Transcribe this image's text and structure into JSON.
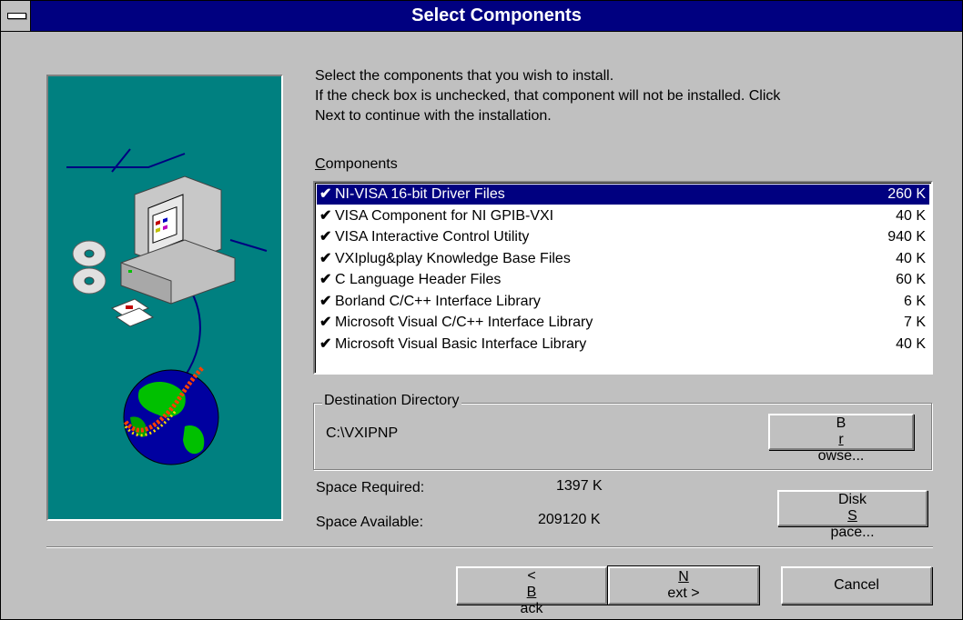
{
  "window": {
    "title": "Select Components"
  },
  "instructions": {
    "line1": "Select the components that you wish to install.",
    "line2": "If the check box is unchecked, that component will not be installed. Click",
    "line3": "Next to continue with the installation."
  },
  "components": {
    "label_first": "C",
    "label_rest": "omponents",
    "items": [
      {
        "name": "NI-VISA 16-bit Driver Files",
        "size": "260 K",
        "checked": true,
        "selected": true
      },
      {
        "name": "VISA Component for NI GPIB-VXI",
        "size": "40 K",
        "checked": true,
        "selected": false
      },
      {
        "name": "VISA Interactive Control Utility",
        "size": "940 K",
        "checked": true,
        "selected": false
      },
      {
        "name": "VXIplug&play Knowledge Base Files",
        "size": "40 K",
        "checked": true,
        "selected": false
      },
      {
        "name": "C Language Header Files",
        "size": "60 K",
        "checked": true,
        "selected": false
      },
      {
        "name": "Borland C/C++ Interface Library",
        "size": "6 K",
        "checked": true,
        "selected": false
      },
      {
        "name": "Microsoft Visual C/C++ Interface Library",
        "size": "7 K",
        "checked": true,
        "selected": false
      },
      {
        "name": "Microsoft Visual Basic Interface Library",
        "size": "40 K",
        "checked": true,
        "selected": false
      }
    ],
    "check_glyph": "✔"
  },
  "destination": {
    "label": "Destination Directory",
    "path": "C:\\VXIPNP",
    "browse_first": "B",
    "browse_ul": "r",
    "browse_rest": "owse..."
  },
  "space": {
    "required_label": "Space Required:",
    "required_value": "1397 K",
    "available_label": "Space Available:",
    "available_value": "209120 K",
    "disk_first": "Disk ",
    "disk_ul": "S",
    "disk_rest": "pace..."
  },
  "buttons": {
    "back_pre": "< ",
    "back_ul": "B",
    "back_rest": "ack",
    "next_ul": "N",
    "next_rest": "ext >",
    "cancel": "Cancel"
  },
  "colors": {
    "titlebar": "#000080",
    "face": "#c0c0c0",
    "art_bg": "#008080",
    "selection": "#000080"
  },
  "icons": {
    "system_menu": "system-menu-icon",
    "illustration": "computer-globe-illustration"
  }
}
